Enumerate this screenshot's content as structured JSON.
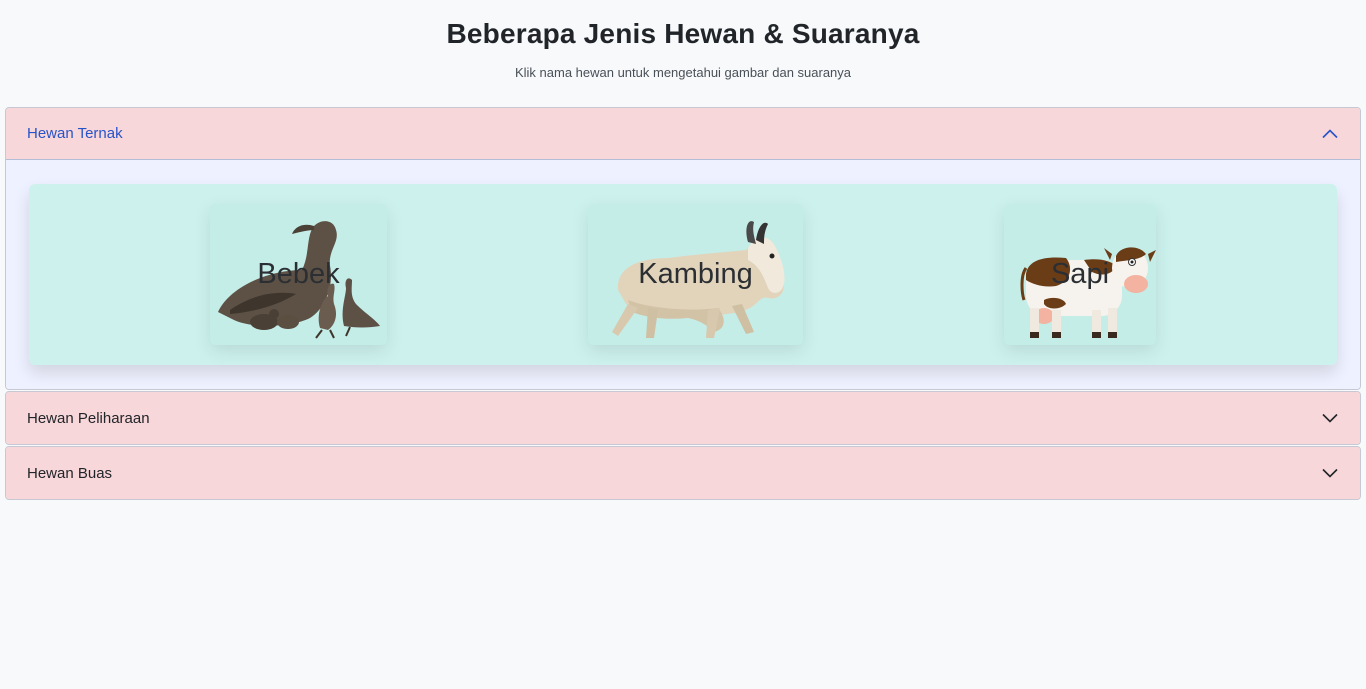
{
  "header": {
    "title": "Beberapa Jenis Hewan & Suaranya",
    "subtitle": "Klik nama hewan untuk mengetahui gambar dan suaranya"
  },
  "accordion": {
    "sections": [
      {
        "label": "Hewan Ternak",
        "expanded": true,
        "icon": "chevron-up-icon",
        "animals": [
          {
            "name": "Bebek",
            "icon": "duck-icon"
          },
          {
            "name": "Kambing",
            "icon": "goat-icon"
          },
          {
            "name": "Sapi",
            "icon": "cow-icon"
          }
        ]
      },
      {
        "label": "Hewan Peliharaan",
        "expanded": false,
        "icon": "chevron-down-icon"
      },
      {
        "label": "Hewan Buas",
        "expanded": false,
        "icon": "chevron-down-icon"
      }
    ]
  },
  "colors": {
    "header_bg": "#f8d7da",
    "active_text": "#2753c9",
    "body_bg": "#eef1ff",
    "panel_bg": "#cdf2ee"
  }
}
